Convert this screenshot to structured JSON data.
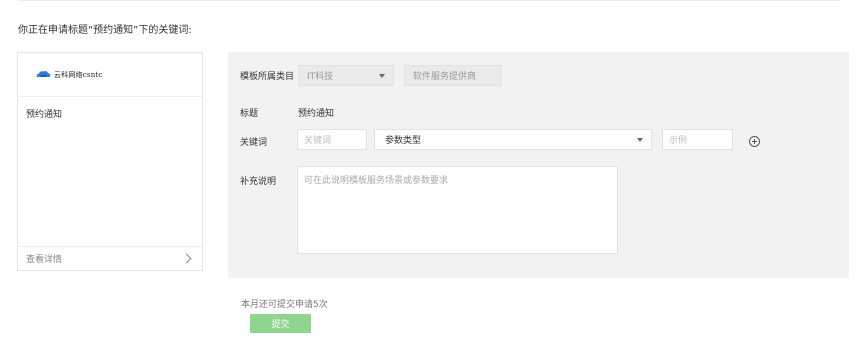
{
  "page": {
    "heading": "你正在申请标题“预约通知”下的关键词:"
  },
  "template_card": {
    "logo_text": "云科网络csntc",
    "name": "预约通知",
    "detail_link": "查看详情"
  },
  "form": {
    "category_label": "模板所属类目",
    "category_primary": "IT科技",
    "category_secondary": "软件服务提供商",
    "title_label": "标题",
    "title_value": "预约通知",
    "keyword_label": "关键词",
    "keyword_placeholder": "关键词",
    "param_type_value": "参数类型",
    "example_placeholder": "示例",
    "supplement_label": "补充说明",
    "supplement_placeholder": "可在此说明模板服务场景或参数要求"
  },
  "footer": {
    "quota_text": "本月还可提交申请5次",
    "submit_label": "提交"
  },
  "colors": {
    "submit_bg": "#8fd48f",
    "panel_bg": "#f2f2f2",
    "logo_blue": "#2f7fd6"
  }
}
